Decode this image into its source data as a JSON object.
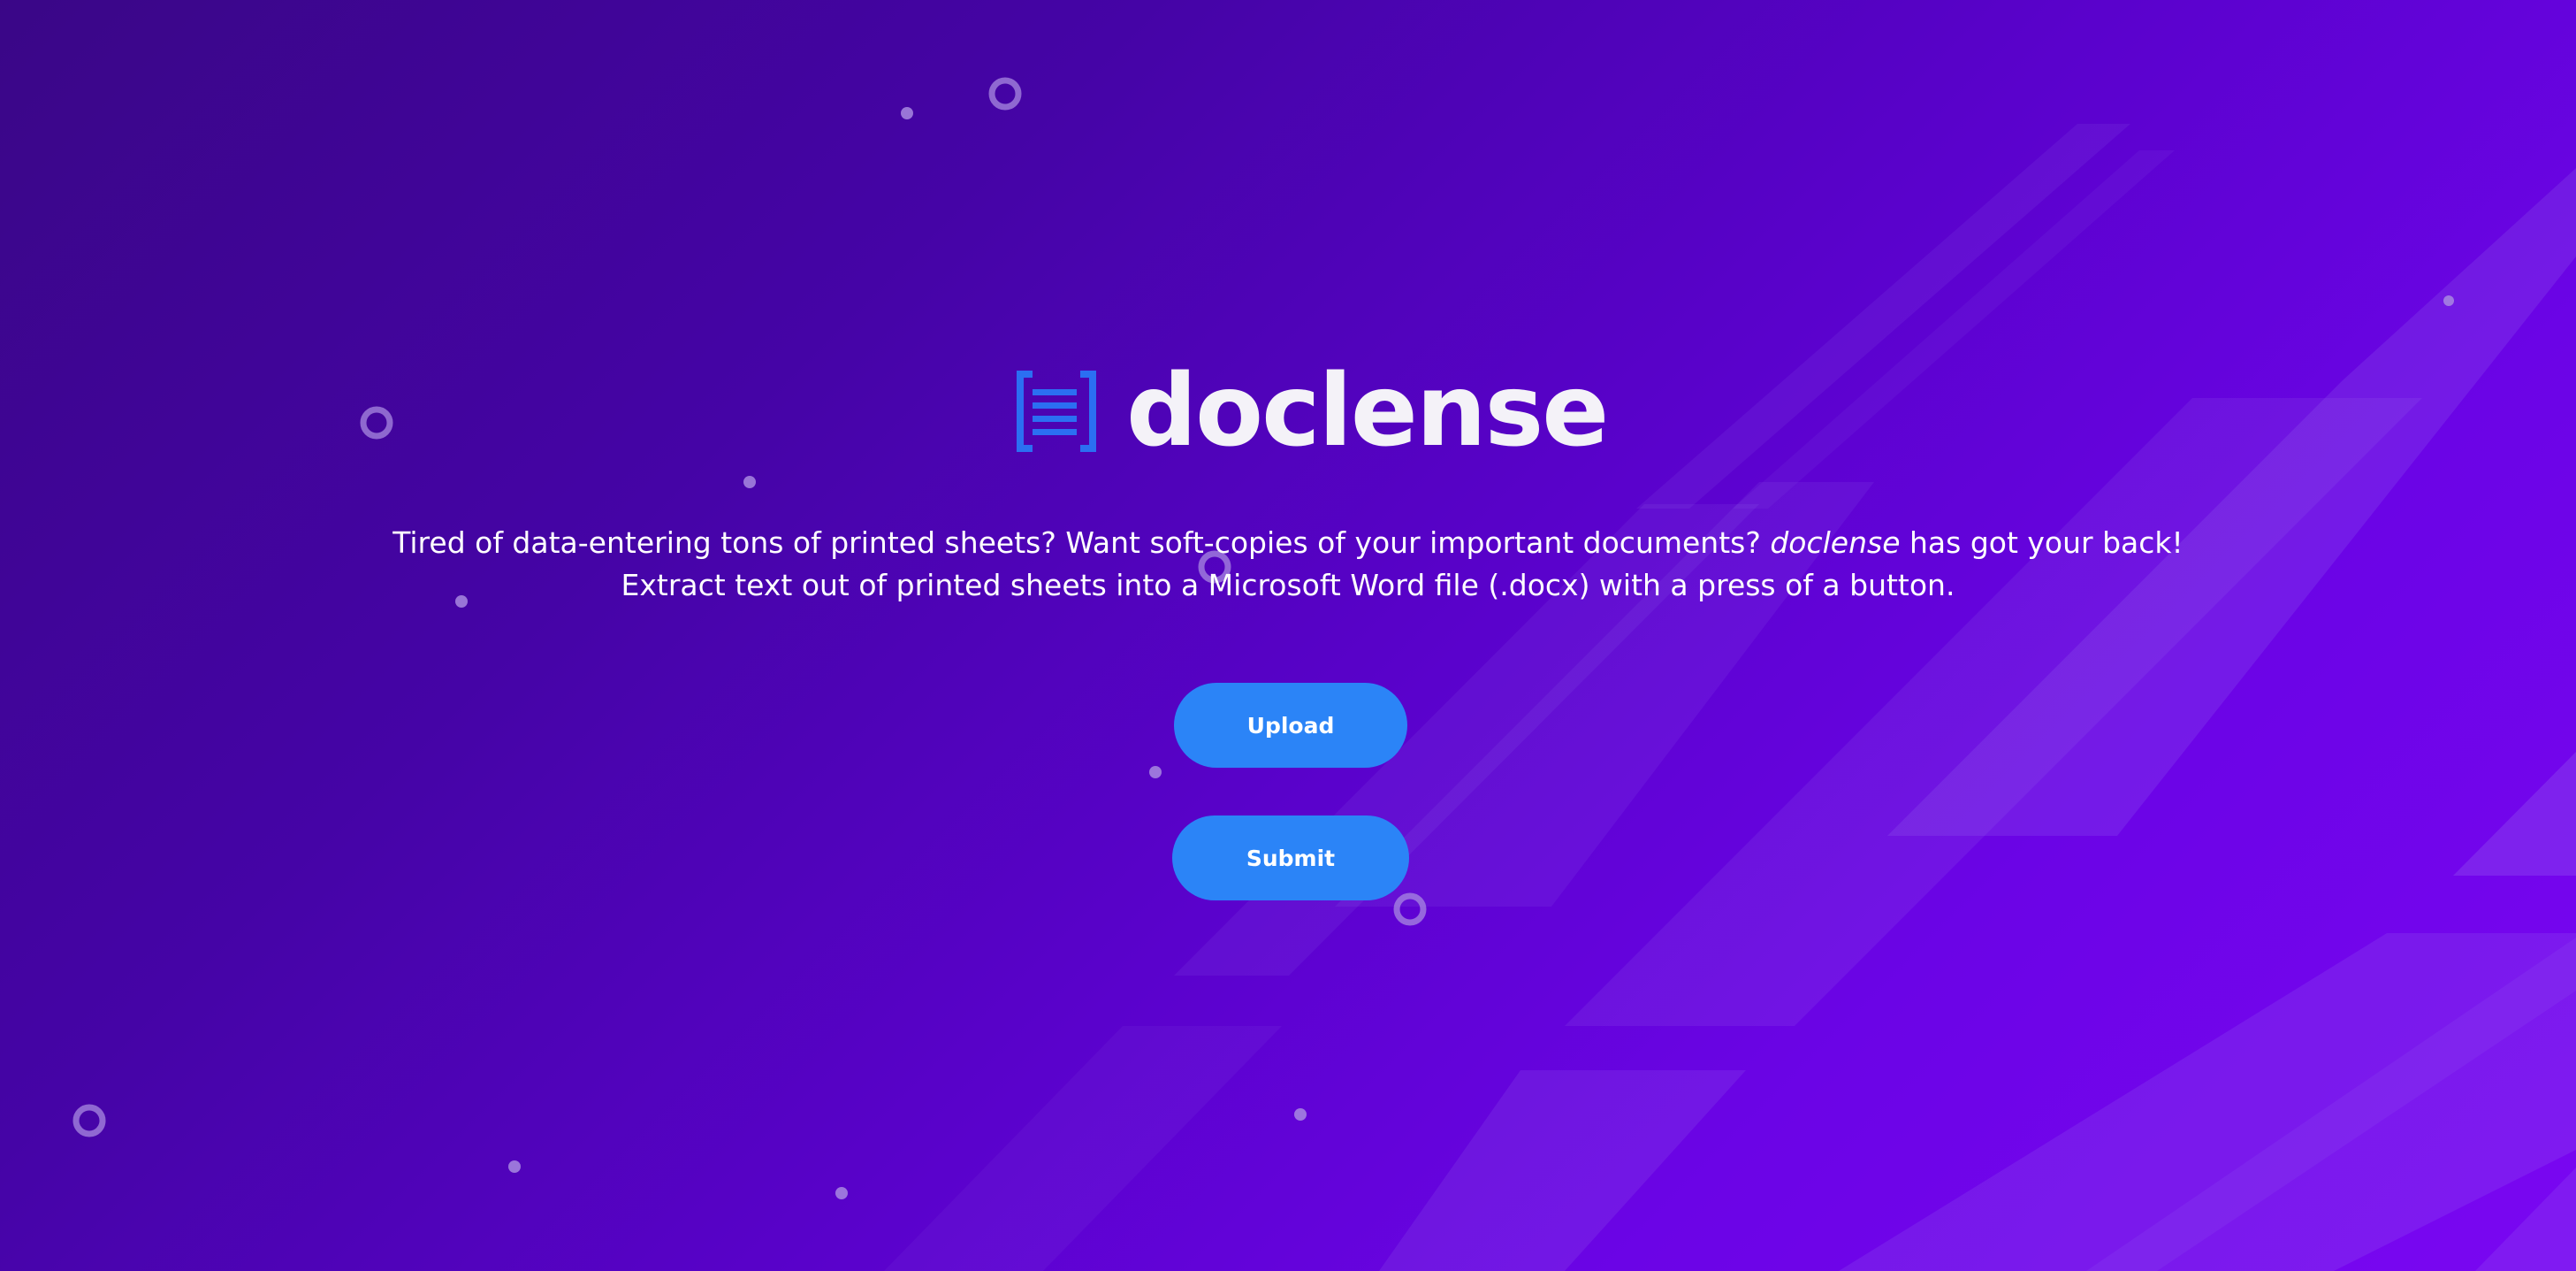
{
  "brand": {
    "name": "doclense",
    "icon": "document-brackets-icon",
    "icon_color": "#2b6ff2"
  },
  "tagline": {
    "line1_before": "Tired of data-entering tons of printed sheets? Want soft-copies of your important documents? ",
    "line1_emphasis": "doclense",
    "line1_after": " has got your back!",
    "line2": "Extract text out of printed sheets into a Microsoft Word file (.docx) with a press of a button."
  },
  "actions": {
    "upload_label": "Upload",
    "submit_label": "Submit"
  },
  "colors": {
    "background_start": "#3a0687",
    "background_end": "#7a06f2",
    "button": "#2b84f7",
    "decor": "#b08cf0"
  }
}
